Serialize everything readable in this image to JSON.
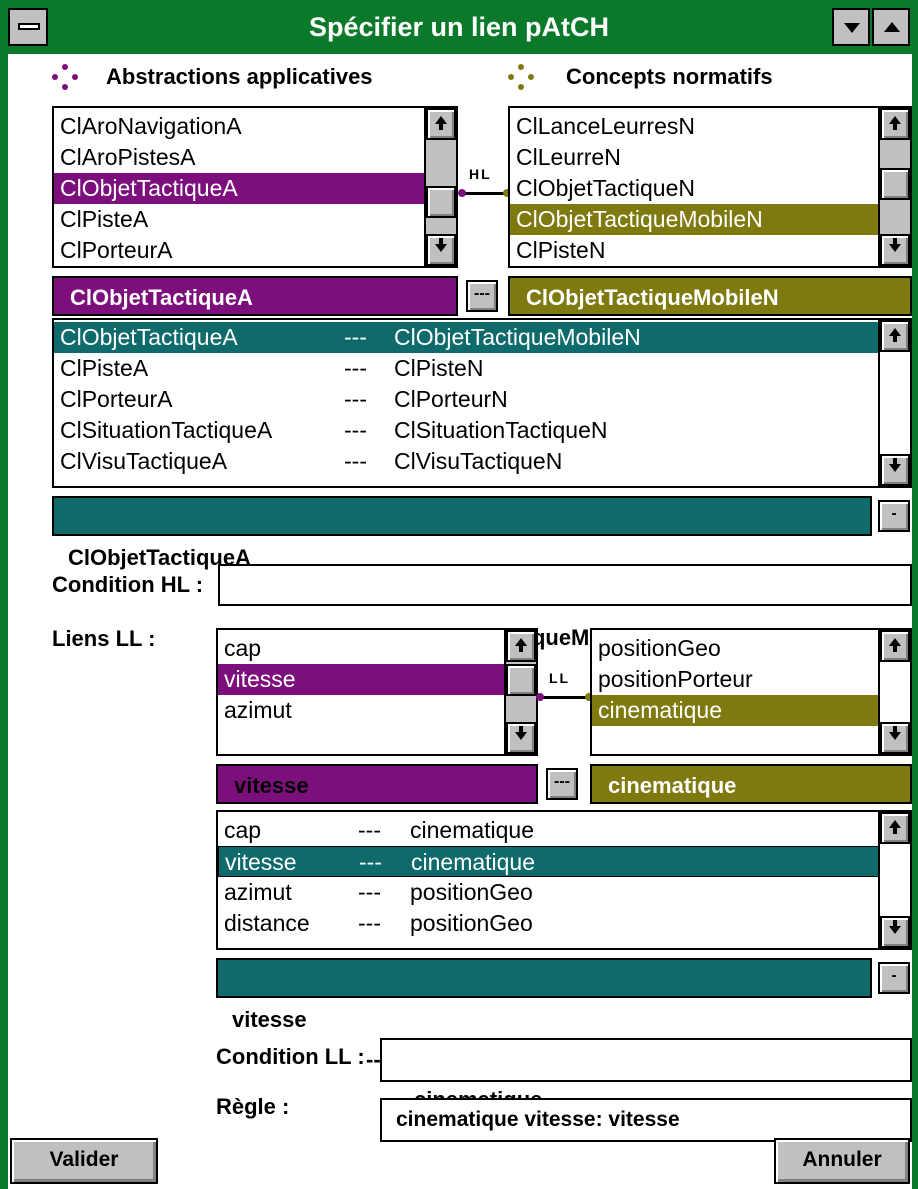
{
  "window": {
    "title": "Spécifier un lien pAtCH"
  },
  "colors": {
    "frame": "#0a7a2a",
    "purple": "#7d0f7d",
    "olive": "#7f7a10",
    "teal": "#0f6b6b"
  },
  "abstractions": {
    "header": "Abstractions applicatives",
    "items": [
      "ClAroNavigationA",
      "ClAroPistesA",
      "ClObjetTactiqueA",
      "ClPisteA",
      "ClPorteurA"
    ],
    "selected": "ClObjetTactiqueA"
  },
  "concepts": {
    "header": "Concepts normatifs",
    "items": [
      "ClLanceLeurresN",
      "ClLeurreN",
      "ClObjetTactiqueN",
      "ClObjetTactiqueMobileN",
      "ClPisteN"
    ],
    "selected": "ClObjetTactiqueMobileN"
  },
  "hl_link_label": "HL",
  "hl_pairs": {
    "rows": [
      {
        "a": "ClObjetTactiqueA",
        "sep": "---",
        "n": "ClObjetTactiqueMobileN"
      },
      {
        "a": "ClPisteA",
        "sep": "---",
        "n": "ClPisteN"
      },
      {
        "a": "ClPorteurA",
        "sep": "---",
        "n": "ClPorteurN"
      },
      {
        "a": "ClSituationTactiqueA",
        "sep": "---",
        "n": "ClSituationTactiqueN"
      },
      {
        "a": "ClVisuTactiqueA",
        "sep": "---",
        "n": "ClVisuTactiqueN"
      }
    ],
    "selected": {
      "a": "ClObjetTactiqueA",
      "sep": "---",
      "n": "ClObjetTactiqueMobileN"
    }
  },
  "link_button_label": "---",
  "remove_button_label": "-",
  "condition_hl": {
    "label": "Condition HL :",
    "value": ""
  },
  "liens_ll": {
    "label": "Liens LL :",
    "left_items": [
      "cap",
      "vitesse",
      "azimut"
    ],
    "left_selected": "vitesse",
    "right_items": [
      "positionGeo",
      "positionPorteur",
      "cinematique"
    ],
    "right_selected": "cinematique",
    "link_label": "LL",
    "pairs": [
      {
        "a": "cap",
        "sep": "---",
        "n": "cinematique"
      },
      {
        "a": "vitesse",
        "sep": "---",
        "n": "cinematique"
      },
      {
        "a": "azimut",
        "sep": "---",
        "n": "positionGeo"
      },
      {
        "a": "distance",
        "sep": "---",
        "n": "positionGeo"
      }
    ],
    "pair_selected": {
      "a": "vitesse",
      "sep": "---",
      "n": "cinematique"
    }
  },
  "condition_ll": {
    "label": "Condition LL :",
    "value": ""
  },
  "regle": {
    "label": "Règle :",
    "value": "cinematique vitesse: vitesse"
  },
  "buttons": {
    "validate": "Valider",
    "cancel": "Annuler"
  }
}
